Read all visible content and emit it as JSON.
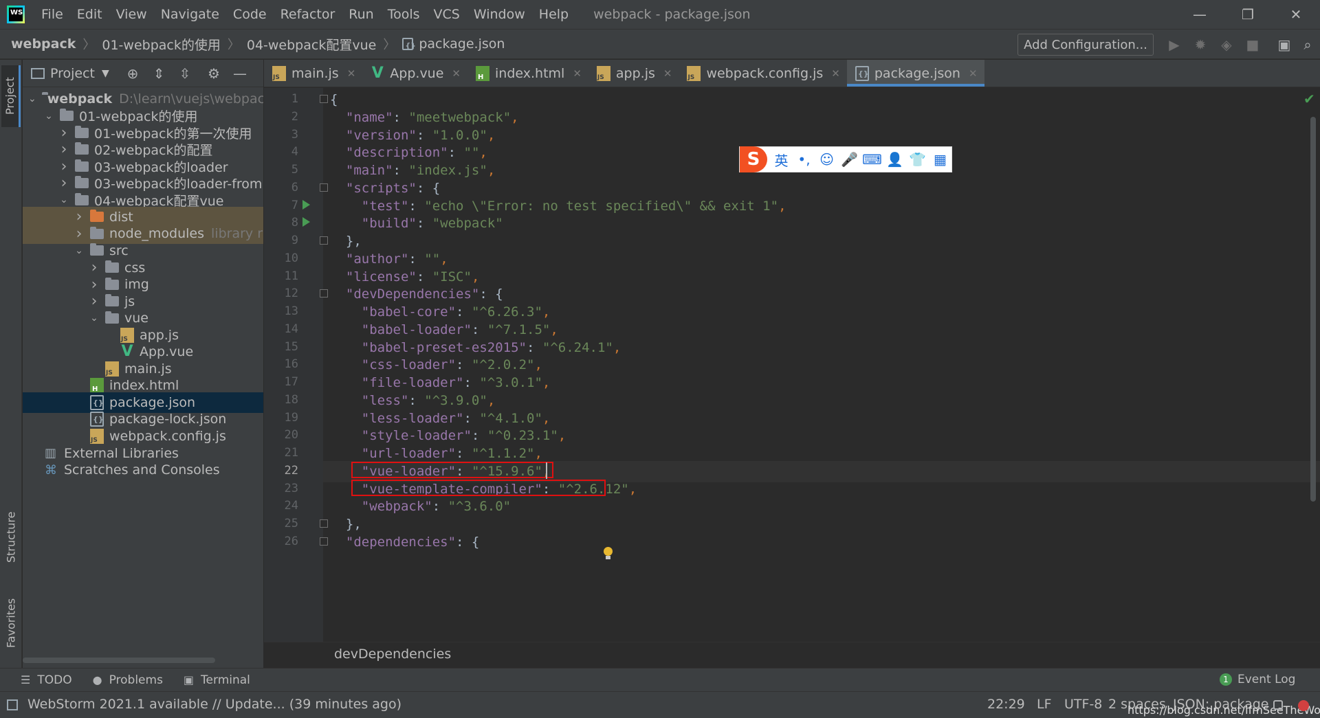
{
  "menubar": {
    "logo": "WS",
    "items": [
      "File",
      "Edit",
      "View",
      "Navigate",
      "Code",
      "Refactor",
      "Run",
      "Tools",
      "VCS",
      "Window",
      "Help"
    ],
    "window_title": "webpack - package.json"
  },
  "window_controls": {
    "minimize": "—",
    "restore": "❐",
    "close": "✕"
  },
  "navbar": {
    "crumbs": [
      "webpack",
      "01-webpack的使用",
      "04-webpack配置vue",
      "package.json"
    ],
    "add_configuration": "Add Configuration..."
  },
  "left_strip": {
    "project": "Project",
    "structure": "Structure",
    "favorites": "Favorites"
  },
  "project_panel": {
    "title": "Project",
    "tree": [
      {
        "label": "webpack",
        "extra": "D:\\learn\\vuejs\\webpack",
        "type": "folder",
        "depth": 0,
        "arrow": "down"
      },
      {
        "label": "01-webpack的使用",
        "type": "folder",
        "depth": 1,
        "arrow": "down"
      },
      {
        "label": "01-webpack的第一次使用",
        "type": "folder",
        "depth": 2,
        "arrow": "right"
      },
      {
        "label": "02-webpack的配置",
        "type": "folder",
        "depth": 2,
        "arrow": "right"
      },
      {
        "label": "03-webpack的loader",
        "type": "folder",
        "depth": 2,
        "arrow": "right"
      },
      {
        "label": "03-webpack的loader-from",
        "type": "folder",
        "depth": 2,
        "arrow": "right"
      },
      {
        "label": "04-webpack配置vue",
        "type": "folder",
        "depth": 2,
        "arrow": "down"
      },
      {
        "label": "dist",
        "type": "folder-orange",
        "depth": 3,
        "arrow": "right",
        "excluded": true
      },
      {
        "label": "node_modules",
        "extra": "library r",
        "type": "folder",
        "depth": 3,
        "arrow": "right",
        "excluded": true
      },
      {
        "label": "src",
        "type": "folder",
        "depth": 3,
        "arrow": "down"
      },
      {
        "label": "css",
        "type": "folder",
        "depth": 4,
        "arrow": "right"
      },
      {
        "label": "img",
        "type": "folder",
        "depth": 4,
        "arrow": "right"
      },
      {
        "label": "js",
        "type": "folder",
        "depth": 4,
        "arrow": "right"
      },
      {
        "label": "vue",
        "type": "folder",
        "depth": 4,
        "arrow": "down"
      },
      {
        "label": "app.js",
        "type": "js",
        "depth": 5
      },
      {
        "label": "App.vue",
        "type": "vue",
        "depth": 5
      },
      {
        "label": "main.js",
        "type": "js",
        "depth": 4
      },
      {
        "label": "index.html",
        "type": "html",
        "depth": 3
      },
      {
        "label": "package.json",
        "type": "json",
        "depth": 3,
        "selected": true
      },
      {
        "label": "package-lock.json",
        "type": "json",
        "depth": 3
      },
      {
        "label": "webpack.config.js",
        "type": "js",
        "depth": 3
      },
      {
        "label": "External Libraries",
        "type": "library",
        "depth": 0
      },
      {
        "label": "Scratches and Consoles",
        "type": "scratch",
        "depth": 0
      }
    ]
  },
  "tabs": [
    {
      "label": "main.js",
      "type": "js"
    },
    {
      "label": "App.vue",
      "type": "vue"
    },
    {
      "label": "index.html",
      "type": "html"
    },
    {
      "label": "app.js",
      "type": "js"
    },
    {
      "label": "webpack.config.js",
      "type": "js"
    },
    {
      "label": "package.json",
      "type": "json",
      "active": true
    }
  ],
  "editor": {
    "lines": [
      [
        {
          "t": "{",
          "c": "d"
        }
      ],
      [
        {
          "t": "  ",
          "c": "d"
        },
        {
          "t": "\"name\"",
          "c": "k"
        },
        {
          "t": ": ",
          "c": "d"
        },
        {
          "t": "\"meetwebpack\"",
          "c": "s"
        },
        {
          "t": ",",
          "c": "p"
        }
      ],
      [
        {
          "t": "  ",
          "c": "d"
        },
        {
          "t": "\"version\"",
          "c": "k"
        },
        {
          "t": ": ",
          "c": "d"
        },
        {
          "t": "\"1.0.0\"",
          "c": "s"
        },
        {
          "t": ",",
          "c": "p"
        }
      ],
      [
        {
          "t": "  ",
          "c": "d"
        },
        {
          "t": "\"description\"",
          "c": "k"
        },
        {
          "t": ": ",
          "c": "d"
        },
        {
          "t": "\"\"",
          "c": "s"
        },
        {
          "t": ",",
          "c": "p"
        }
      ],
      [
        {
          "t": "  ",
          "c": "d"
        },
        {
          "t": "\"main\"",
          "c": "k"
        },
        {
          "t": ": ",
          "c": "d"
        },
        {
          "t": "\"index.js\"",
          "c": "s"
        },
        {
          "t": ",",
          "c": "p"
        }
      ],
      [
        {
          "t": "  ",
          "c": "d"
        },
        {
          "t": "\"scripts\"",
          "c": "k"
        },
        {
          "t": ": {",
          "c": "d"
        }
      ],
      [
        {
          "t": "    ",
          "c": "d"
        },
        {
          "t": "\"test\"",
          "c": "k"
        },
        {
          "t": ": ",
          "c": "d"
        },
        {
          "t": "\"echo \\\"Error: no test specified\\\" && exit 1\"",
          "c": "s"
        },
        {
          "t": ",",
          "c": "p"
        }
      ],
      [
        {
          "t": "    ",
          "c": "d"
        },
        {
          "t": "\"build\"",
          "c": "k"
        },
        {
          "t": ": ",
          "c": "d"
        },
        {
          "t": "\"webpack\"",
          "c": "s"
        }
      ],
      [
        {
          "t": "  },",
          "c": "d"
        }
      ],
      [
        {
          "t": "  ",
          "c": "d"
        },
        {
          "t": "\"author\"",
          "c": "k"
        },
        {
          "t": ": ",
          "c": "d"
        },
        {
          "t": "\"\"",
          "c": "s"
        },
        {
          "t": ",",
          "c": "p"
        }
      ],
      [
        {
          "t": "  ",
          "c": "d"
        },
        {
          "t": "\"license\"",
          "c": "k"
        },
        {
          "t": ": ",
          "c": "d"
        },
        {
          "t": "\"ISC\"",
          "c": "s"
        },
        {
          "t": ",",
          "c": "p"
        }
      ],
      [
        {
          "t": "  ",
          "c": "d"
        },
        {
          "t": "\"devDependencies\"",
          "c": "k"
        },
        {
          "t": ": {",
          "c": "d"
        }
      ],
      [
        {
          "t": "    ",
          "c": "d"
        },
        {
          "t": "\"babel-core\"",
          "c": "k"
        },
        {
          "t": ": ",
          "c": "d"
        },
        {
          "t": "\"^6.26.3\"",
          "c": "s"
        },
        {
          "t": ",",
          "c": "p"
        }
      ],
      [
        {
          "t": "    ",
          "c": "d"
        },
        {
          "t": "\"babel-loader\"",
          "c": "k"
        },
        {
          "t": ": ",
          "c": "d"
        },
        {
          "t": "\"^7.1.5\"",
          "c": "s"
        },
        {
          "t": ",",
          "c": "p"
        }
      ],
      [
        {
          "t": "    ",
          "c": "d"
        },
        {
          "t": "\"babel-preset-es2015\"",
          "c": "k"
        },
        {
          "t": ": ",
          "c": "d"
        },
        {
          "t": "\"^6.24.1\"",
          "c": "s"
        },
        {
          "t": ",",
          "c": "p"
        }
      ],
      [
        {
          "t": "    ",
          "c": "d"
        },
        {
          "t": "\"css-loader\"",
          "c": "k"
        },
        {
          "t": ": ",
          "c": "d"
        },
        {
          "t": "\"^2.0.2\"",
          "c": "s"
        },
        {
          "t": ",",
          "c": "p"
        }
      ],
      [
        {
          "t": "    ",
          "c": "d"
        },
        {
          "t": "\"file-loader\"",
          "c": "k"
        },
        {
          "t": ": ",
          "c": "d"
        },
        {
          "t": "\"^3.0.1\"",
          "c": "s"
        },
        {
          "t": ",",
          "c": "p"
        }
      ],
      [
        {
          "t": "    ",
          "c": "d"
        },
        {
          "t": "\"less\"",
          "c": "k"
        },
        {
          "t": ": ",
          "c": "d"
        },
        {
          "t": "\"^3.9.0\"",
          "c": "s"
        },
        {
          "t": ",",
          "c": "p"
        }
      ],
      [
        {
          "t": "    ",
          "c": "d"
        },
        {
          "t": "\"less-loader\"",
          "c": "k"
        },
        {
          "t": ": ",
          "c": "d"
        },
        {
          "t": "\"^4.1.0\"",
          "c": "s"
        },
        {
          "t": ",",
          "c": "p"
        }
      ],
      [
        {
          "t": "    ",
          "c": "d"
        },
        {
          "t": "\"style-loader\"",
          "c": "k"
        },
        {
          "t": ": ",
          "c": "d"
        },
        {
          "t": "\"^0.23.1\"",
          "c": "s"
        },
        {
          "t": ",",
          "c": "p"
        }
      ],
      [
        {
          "t": "    ",
          "c": "d"
        },
        {
          "t": "\"url-loader\"",
          "c": "k"
        },
        {
          "t": ": ",
          "c": "d"
        },
        {
          "t": "\"^1.1.2\"",
          "c": "s"
        },
        {
          "t": ",",
          "c": "p"
        }
      ],
      [
        {
          "t": "    ",
          "c": "d"
        },
        {
          "t": "\"vue-loader\"",
          "c": "k"
        },
        {
          "t": ": ",
          "c": "d"
        },
        {
          "t": "\"^15.9.6\"",
          "c": "s"
        },
        {
          "t": ",",
          "c": "p"
        }
      ],
      [
        {
          "t": "    ",
          "c": "d"
        },
        {
          "t": "\"vue-template-compiler\"",
          "c": "k"
        },
        {
          "t": ": ",
          "c": "d"
        },
        {
          "t": "\"^2.6.12\"",
          "c": "s"
        },
        {
          "t": ",",
          "c": "p"
        }
      ],
      [
        {
          "t": "    ",
          "c": "d"
        },
        {
          "t": "\"webpack\"",
          "c": "k"
        },
        {
          "t": ": ",
          "c": "d"
        },
        {
          "t": "\"^3.6.0\"",
          "c": "s"
        }
      ],
      [
        {
          "t": "  },",
          "c": "d"
        }
      ],
      [
        {
          "t": "  ",
          "c": "d"
        },
        {
          "t": "\"dependencies\"",
          "c": "k"
        },
        {
          "t": ": {",
          "c": "d"
        }
      ]
    ],
    "current_line": 22,
    "run_lines": [
      7,
      8
    ],
    "fold_lines": [
      1,
      6,
      9,
      12,
      25,
      26
    ],
    "highlighted_lines": [
      22,
      23
    ]
  },
  "ime": {
    "logo": "S",
    "items": [
      "英",
      "•,",
      "☺",
      "🎤",
      "⌨",
      "👤",
      "👕",
      "▦"
    ]
  },
  "editor_breadcrumb": "devDependencies",
  "tool_windows": [
    {
      "label": "TODO",
      "icon": "☰"
    },
    {
      "label": "Problems",
      "icon": "●"
    },
    {
      "label": "Terminal",
      "icon": "▣"
    }
  ],
  "event_log": {
    "label": "Event Log",
    "count": "1"
  },
  "status": {
    "message": "WebStorm 2021.1 available // Update... (39 minutes ago)",
    "position": "22:29",
    "line_sep": "LF",
    "encoding": "UTF-8",
    "indent": "2 spaces",
    "file_type": "JSON: package",
    "watermark": "https://blog.csdn.net/ifmSeeTheWorld"
  }
}
